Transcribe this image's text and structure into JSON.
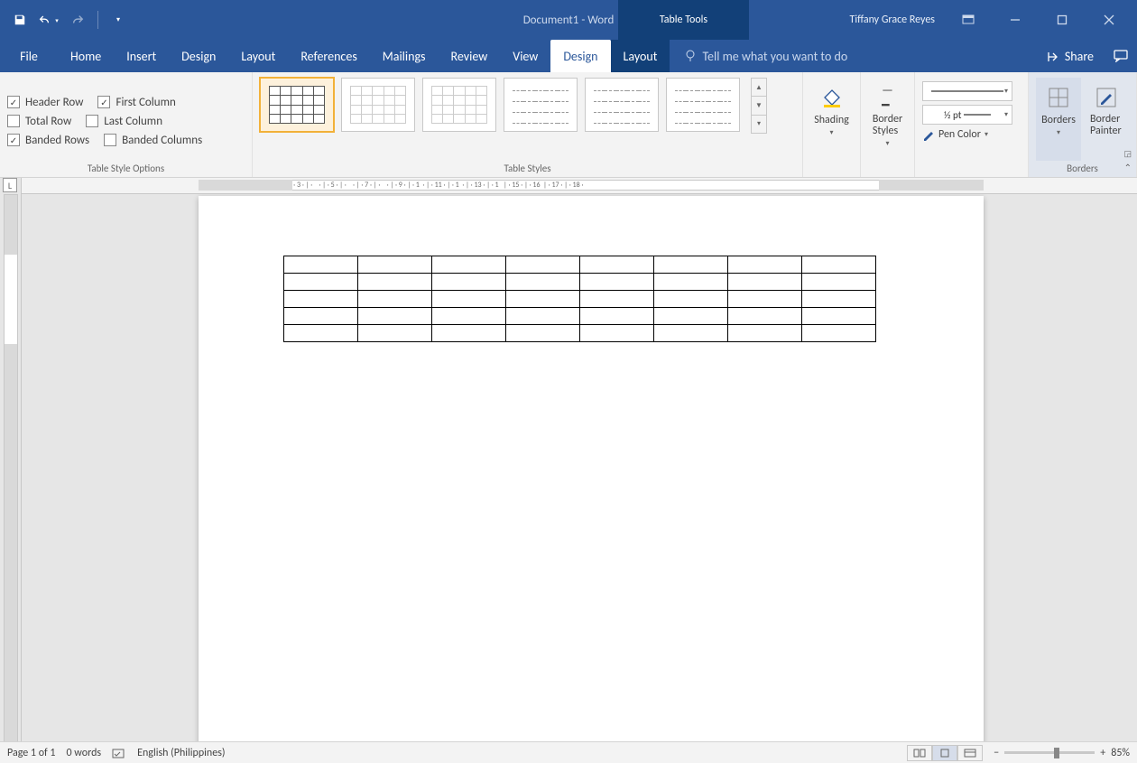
{
  "title": {
    "doc": "Document1",
    "app": "Word"
  },
  "table_tools_label": "Table Tools",
  "user_name": "Tiffany Grace Reyes",
  "tabs": {
    "file": "File",
    "list": [
      "Home",
      "Insert",
      "Design",
      "Layout",
      "References",
      "Mailings",
      "Review",
      "View"
    ],
    "context": [
      "Design",
      "Layout"
    ],
    "active_context_index": 0
  },
  "tellme_placeholder": "Tell me what you want to do",
  "share_label": "Share",
  "table_style_options": {
    "group_label": "Table Style Options",
    "header_row": {
      "label": "Header Row",
      "checked": true
    },
    "total_row": {
      "label": "Total Row",
      "checked": false
    },
    "banded_rows": {
      "label": "Banded Rows",
      "checked": true
    },
    "first_column": {
      "label": "First Column",
      "checked": true
    },
    "last_column": {
      "label": "Last Column",
      "checked": false
    },
    "banded_columns": {
      "label": "Banded Columns",
      "checked": false
    }
  },
  "table_styles_group_label": "Table Styles",
  "shading_label": "Shading",
  "border_styles_label": "Border Styles",
  "pen_weight": "½ pt",
  "pen_color_label": "Pen Color",
  "borders_group_label": "Borders",
  "borders_btn_label": "Borders",
  "border_painter_label": "Border Painter",
  "status": {
    "page": "Page 1 of 1",
    "words": "0 words",
    "lang": "English (Philippines)",
    "zoom": "85%"
  },
  "doc_table": {
    "rows": 5,
    "cols": 8
  }
}
